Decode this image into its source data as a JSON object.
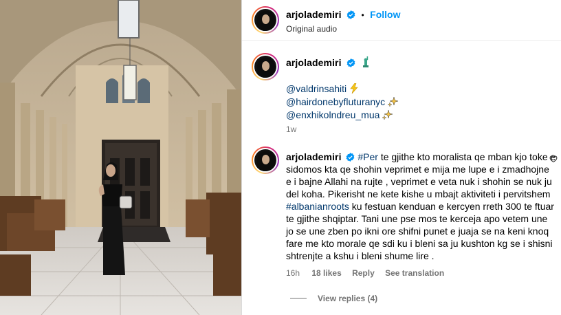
{
  "post": {
    "username": "arjolademiri",
    "follow_label": "Follow",
    "dot": "•",
    "audio": "Original audio"
  },
  "caption": {
    "username": "arjolademiri",
    "mentions": [
      "@valdrinsahiti",
      "@hairdonebyfluturanyc",
      "@enxhikolndreu_mua"
    ],
    "time": "1w"
  },
  "comment": {
    "username": "arjolademiri",
    "line1_hashtag": "#Per",
    "line1_rest": " te gjithe kto moralista qe mban kjo toke e",
    "line2": "sidomos kta qe shohin veprimet e mija me lupe e i zmadhojne",
    "line3": "e i bajne Allahi na rujte , veprimet e veta nuk i shohin se nuk ju",
    "line4": "del koha. Pikerisht ne kete kishe u mbajt aktiviteti i pervitshem",
    "line5_hashtag": "#albanianroots",
    "line5_rest": " ku festuan kenduan e kercyen rreth 300 te ftuar",
    "line6": "te gjithe shqiptar. Tani une pse mos te kerceja apo vetem une",
    "line7": "jo se une zben po ikni ore shifni punet e juaja se na keni knoq",
    "line8": "fare me kto morale qe sdi ku i bleni sa ju kushton kg se i shisni",
    "line9": "shtrenjte a kshu i bleni shume lire .",
    "time": "16h",
    "likes": "18 likes",
    "reply": "Reply",
    "translation": "See translation",
    "view_replies": "View replies (4)"
  },
  "icons": {
    "verified": "verified-badge-icon",
    "statue": "statue-of-liberty-icon",
    "lightning": "lightning-icon",
    "sparkles": "sparkles-icon",
    "heart": "heart-outline-icon"
  },
  "colors": {
    "follow": "#0095f6",
    "link": "#00376b",
    "verified": "#0095f6",
    "muted": "#737373"
  }
}
